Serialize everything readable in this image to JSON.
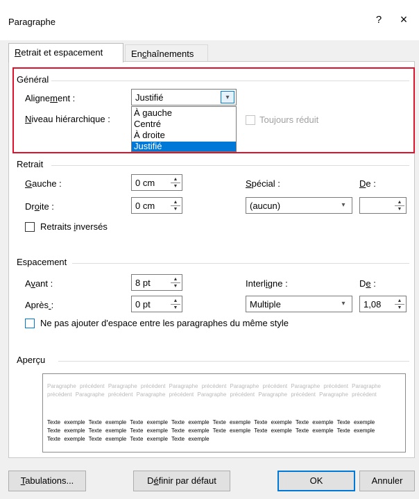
{
  "window": {
    "title": "Paragraphe",
    "help_icon": "?",
    "close_icon": "×"
  },
  "tabs": [
    {
      "label_html": "<u>R</u>etrait et espacement",
      "active": true
    },
    {
      "label_html": "En<u>c</u>haînements",
      "active": false
    }
  ],
  "general": {
    "title": "Général",
    "alignment_label_html": "Aligne<u>m</u>ent :",
    "alignment_value": "Justifié",
    "level_label_html": "<u>N</u>iveau hiérarchique :",
    "collapsed_label": "Toujours réduit",
    "dropdown_options": [
      "À gauche",
      "Centré",
      "À droite",
      "Justifié"
    ],
    "selected_option": "Justifié"
  },
  "retrait": {
    "title": "Retrait",
    "gauche_label_html": "<u>G</u>auche :",
    "gauche_value": "0 cm",
    "droite_label_html": "Dr<u>o</u>ite :",
    "droite_value": "0 cm",
    "special_label_html": "<u>S</u>pécial :",
    "special_value": "(aucun)",
    "de_label_html": "<u>D</u>e :",
    "de_value": "",
    "mirror_label_html": "Retraits <u>i</u>nversés"
  },
  "espacement": {
    "title": "Espacement",
    "avant_label_html": "A<u>v</u>ant :",
    "avant_value": "8 pt",
    "apres_label_html": "Après<u> </u>:",
    "apres_value": "0 pt",
    "interligne_label_html": "Interl<u>i</u>gne :",
    "interligne_value": "Multiple",
    "de_label_html": "D<u>e</u> :",
    "de_value": "1,08",
    "no_space_label_html": "Ne pas a<u>j</u>outer d'espace entre les paragraphes du même style"
  },
  "apercu": {
    "title": "Aperçu",
    "previous_text": "Paragraphe précédent Paragraphe précédent Paragraphe précédent Paragraphe précédent Paragraphe précédent Paragraphe précédent Paragraphe précédent Paragraphe précédent Paragraphe précédent Paragraphe précédent Paragraphe précédent",
    "sample_text": "Texte exemple Texte exemple Texte exemple Texte exemple Texte exemple Texte exemple Texte exemple Texte exemple Texte exemple Texte exemple Texte exemple Texte exemple Texte exemple Texte exemple Texte exemple Texte exemple Texte exemple Texte exemple Texte exemple Texte exemple"
  },
  "buttons": {
    "tabs_html": "<u>T</u>abulations...",
    "default_html": "D<u>é</u>finir par défaut",
    "ok": "OK",
    "cancel": "Annuler"
  },
  "colors": {
    "highlight": "#e0112b",
    "selection": "#0078d7"
  }
}
